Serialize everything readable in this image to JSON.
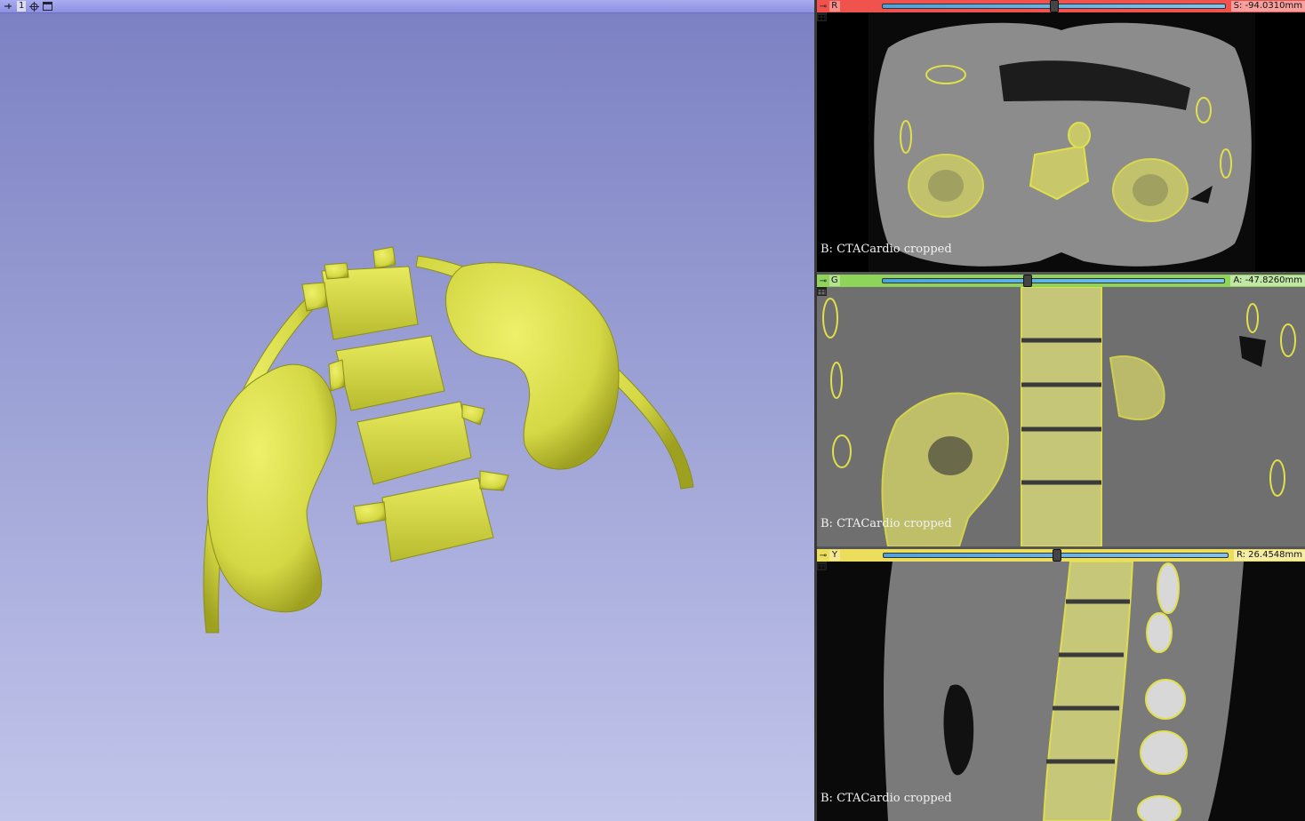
{
  "view3d": {
    "view_number": "1",
    "colors": {
      "background_top": "#7b80c3",
      "background_bottom": "#c2c5ea",
      "model": "#d8dc4c"
    },
    "icons": [
      "pin-icon",
      "center-view-icon",
      "maximize-view-icon"
    ]
  },
  "slices": [
    {
      "id": "red",
      "letter": "R",
      "coordinate": "S: -94.0310mm",
      "label": "B: CTACardio cropped",
      "slider_position": 0.5,
      "color": "#f0534e"
    },
    {
      "id": "green",
      "letter": "G",
      "coordinate": "A: -47.8260mm",
      "label": "B: CTACardio cropped",
      "slider_position": 0.42,
      "color": "#8ed45a"
    },
    {
      "id": "yellow",
      "letter": "Y",
      "coordinate": "R: 26.4548mm",
      "label": "B: CTACardio cropped",
      "slider_position": 0.5,
      "color": "#eddd5c"
    }
  ]
}
